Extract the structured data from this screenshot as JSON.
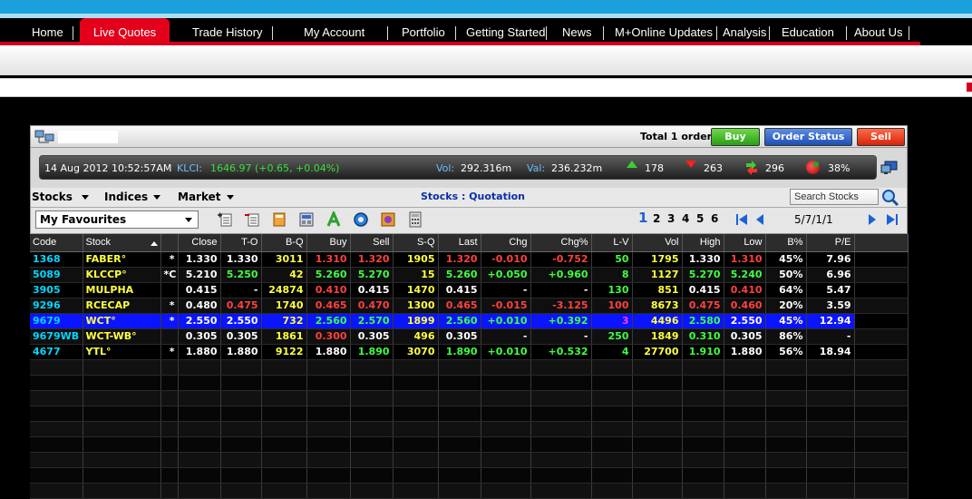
{
  "nav": {
    "items": [
      {
        "label": "Home"
      },
      {
        "label": "Live Quotes",
        "active": true
      },
      {
        "label": "Trade History"
      },
      {
        "label": "My Account"
      },
      {
        "label": "Portfolio"
      },
      {
        "label": "Getting Started"
      },
      {
        "label": "News"
      },
      {
        "label": "M+Online Updates"
      },
      {
        "label": "Analysis"
      },
      {
        "label": "Education"
      },
      {
        "label": "About Us"
      }
    ]
  },
  "colors": {
    "nav_accent": "#e3001b",
    "top_stripe": "#1aa0dd",
    "selected_row": "#0a14ff"
  },
  "order_bar": {
    "total_label": "Total 1 order",
    "buy_label": "Buy",
    "status_label": "Order Status",
    "sell_label": "Sell"
  },
  "ticker": {
    "datetime": "14 Aug 2012 10:52:57AM",
    "klci_label": "KLCI:",
    "klci_value": "1646.97 (+0.65, +0.04%)",
    "vol_label": "Vol:",
    "vol_value": "292.316m",
    "val_label": "Val:",
    "val_value": "236.232m",
    "up_count": "178",
    "down_count": "263",
    "unchanged_count": "296",
    "pct": "38%"
  },
  "menus": {
    "stocks": "Stocks",
    "indices": "Indices",
    "market": "Market",
    "title": "Stocks : Quotation",
    "search_placeholder": "Search Stocks"
  },
  "toolbar": {
    "favourites": "My Favourites",
    "pages": [
      "1",
      "2",
      "3",
      "4",
      "5",
      "6"
    ],
    "pager": "5/7/1/1"
  },
  "table": {
    "columns": [
      "Code",
      "Stock",
      "",
      "Close",
      "T-O",
      "B-Q",
      "Buy",
      "Sell",
      "S-Q",
      "Last",
      "Chg",
      "Chg%",
      "L-V",
      "Vol",
      "High",
      "Low",
      "B%",
      "P/E"
    ],
    "rows": [
      {
        "code": "1368",
        "stock": "FABER°",
        "flag": "*",
        "close": "1.330",
        "to": "1.330",
        "bq": "3011",
        "buy": "1.310",
        "sell": "1.320",
        "sq": "1905",
        "last": "1.320",
        "chg": "-0.010",
        "chgp": "-0.752",
        "lv": "50",
        "vol": "1795",
        "high": "1.330",
        "low": "1.310",
        "bp": "45%",
        "pe": "7.96"
      },
      {
        "code": "5089",
        "stock": "KLCCP°",
        "flag": "*C",
        "close": "5.210",
        "to": "5.250",
        "bq": "42",
        "buy": "5.260",
        "sell": "5.270",
        "sq": "15",
        "last": "5.260",
        "chg": "+0.050",
        "chgp": "+0.960",
        "lv": "8",
        "vol": "1127",
        "high": "5.270",
        "low": "5.240",
        "bp": "50%",
        "pe": "6.96"
      },
      {
        "code": "3905",
        "stock": "MULPHA",
        "flag": "",
        "close": "0.415",
        "to": "-",
        "bq": "24874",
        "buy": "0.410",
        "sell": "0.415",
        "sq": "1470",
        "last": "0.415",
        "chg": "-",
        "chgp": "-",
        "lv": "130",
        "vol": "851",
        "high": "0.415",
        "low": "0.410",
        "bp": "64%",
        "pe": "5.47"
      },
      {
        "code": "9296",
        "stock": "RCECAP",
        "flag": "*",
        "close": "0.480",
        "to": "0.475",
        "bq": "1740",
        "buy": "0.465",
        "sell": "0.470",
        "sq": "1300",
        "last": "0.465",
        "chg": "-0.015",
        "chgp": "-3.125",
        "lv": "100",
        "vol": "8673",
        "high": "0.475",
        "low": "0.460",
        "bp": "20%",
        "pe": "3.59"
      },
      {
        "code": "9679",
        "stock": "WCT°",
        "flag": "*",
        "close": "2.550",
        "to": "2.550",
        "bq": "732",
        "buy": "2.560",
        "sell": "2.570",
        "sq": "1899",
        "last": "2.560",
        "chg": "+0.010",
        "chgp": "+0.392",
        "lv": "3",
        "vol": "4496",
        "high": "2.580",
        "low": "2.550",
        "bp": "45%",
        "pe": "12.94"
      },
      {
        "code": "9679WB",
        "stock": "WCT-WB°",
        "flag": "",
        "close": "0.305",
        "to": "0.305",
        "bq": "1861",
        "buy": "0.300",
        "sell": "0.305",
        "sq": "496",
        "last": "0.305",
        "chg": "-",
        "chgp": "-",
        "lv": "250",
        "vol": "1849",
        "high": "0.310",
        "low": "0.305",
        "bp": "86%",
        "pe": "-"
      },
      {
        "code": "4677",
        "stock": "YTL°",
        "flag": "*",
        "close": "1.880",
        "to": "1.880",
        "bq": "9122",
        "buy": "1.880",
        "sell": "1.890",
        "sq": "3070",
        "last": "1.890",
        "chg": "+0.010",
        "chgp": "+0.532",
        "lv": "4",
        "vol": "27700",
        "high": "1.910",
        "low": "1.880",
        "bp": "56%",
        "pe": "18.94"
      }
    ]
  }
}
